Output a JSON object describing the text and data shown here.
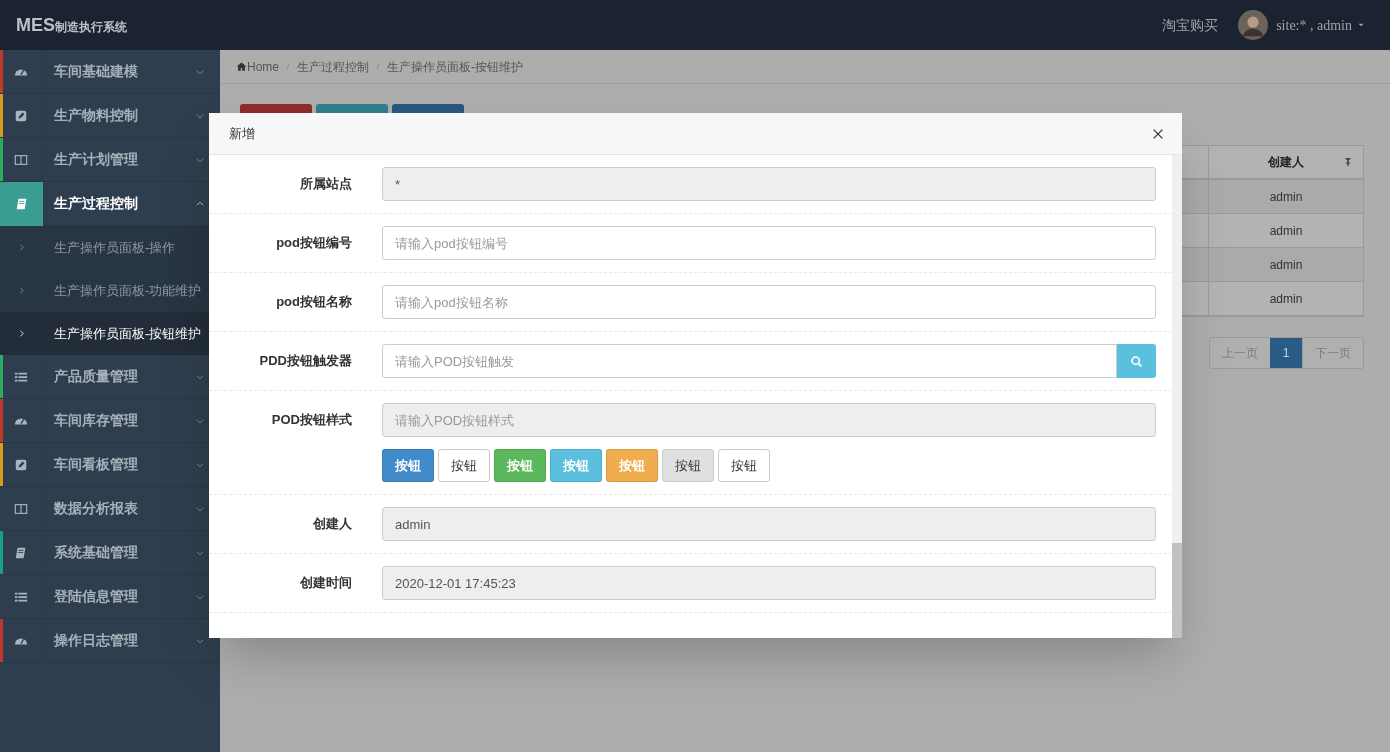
{
  "header": {
    "logo_main": "MES",
    "logo_sub": "制造执行系统",
    "link": "淘宝购买",
    "user": "site:* , admin"
  },
  "sidebar": {
    "items": [
      {
        "label": "车间基础建模",
        "color": "#c0392b",
        "expanded": false,
        "selected": false
      },
      {
        "label": "生产物料控制",
        "color": "#d4a017",
        "expanded": false,
        "selected": false
      },
      {
        "label": "生产计划管理",
        "color": "#27ae60",
        "expanded": false,
        "selected": false
      },
      {
        "label": "生产过程控制",
        "expanded": true,
        "selected": true,
        "children": [
          {
            "label": "生产操作员面板-操作",
            "selected": false
          },
          {
            "label": "生产操作员面板-功能维护",
            "selected": false
          },
          {
            "label": "生产操作员面板-按钮维护",
            "selected": true
          }
        ]
      },
      {
        "label": "产品质量管理",
        "color": "#27ae60",
        "expanded": false,
        "selected": false
      },
      {
        "label": "车间库存管理",
        "color": "#c0392b",
        "expanded": false,
        "selected": false
      },
      {
        "label": "车间看板管理",
        "color": "#d4a017",
        "expanded": false,
        "selected": false
      },
      {
        "label": "数据分析报表",
        "expanded": false,
        "selected": false
      },
      {
        "label": "系统基础管理",
        "color": "#16a085",
        "expanded": false,
        "selected": false
      },
      {
        "label": "登陆信息管理",
        "expanded": false,
        "selected": false
      },
      {
        "label": "操作日志管理",
        "color": "#c0392b",
        "expanded": false,
        "selected": false
      }
    ]
  },
  "breadcrumb": [
    "Home",
    "生产过程控制",
    "生产操作员面板-按钮维护"
  ],
  "toolbar": [
    {
      "color": "#8e2c2a"
    },
    {
      "color": "#2f7f8c"
    },
    {
      "color": "#2a5680"
    }
  ],
  "table": {
    "columns": [
      "创建人"
    ],
    "rows": [
      [
        "admin"
      ],
      [
        "admin"
      ],
      [
        "admin"
      ],
      [
        "admin"
      ]
    ]
  },
  "pagination": [
    {
      "label": "上一页",
      "selected": false
    },
    {
      "label": "1",
      "selected": true
    },
    {
      "label": "下一页",
      "selected": false
    }
  ],
  "modal": {
    "title": "新增",
    "fields": [
      {
        "kind": "text",
        "label": "所属站点",
        "value": "*",
        "disabled": true
      },
      {
        "kind": "text",
        "label": "pod按钮编号",
        "placeholder": "请输入pod按钮编号",
        "disabled": false
      },
      {
        "kind": "text",
        "label": "pod按钮名称",
        "placeholder": "请输入pod按钮名称",
        "disabled": false
      },
      {
        "kind": "search",
        "label": "PDD按钮触发器",
        "placeholder": "请输入POD按钮触发",
        "disabled": false
      },
      {
        "kind": "style",
        "label": "POD按钮样式",
        "placeholder": "请输入POD按钮样式",
        "disabled": true,
        "buttons": [
          {
            "label": "按钮",
            "color": "#428bca"
          },
          {
            "label": "按钮",
            "color": "#ffffff"
          },
          {
            "label": "按钮",
            "color": "#5cb85c"
          },
          {
            "label": "按钮",
            "color": "#5bc0de"
          },
          {
            "label": "按钮",
            "color": "#f0ad4e"
          },
          {
            "label": "按钮",
            "color": "#e0e0e0"
          },
          {
            "label": "按钮",
            "color": "#ffffff"
          }
        ]
      },
      {
        "kind": "text",
        "label": "创建人",
        "value": "admin",
        "disabled": true
      },
      {
        "kind": "text",
        "label": "创建时间",
        "value": "2020-12-01 17:45:23",
        "disabled": true
      }
    ]
  }
}
